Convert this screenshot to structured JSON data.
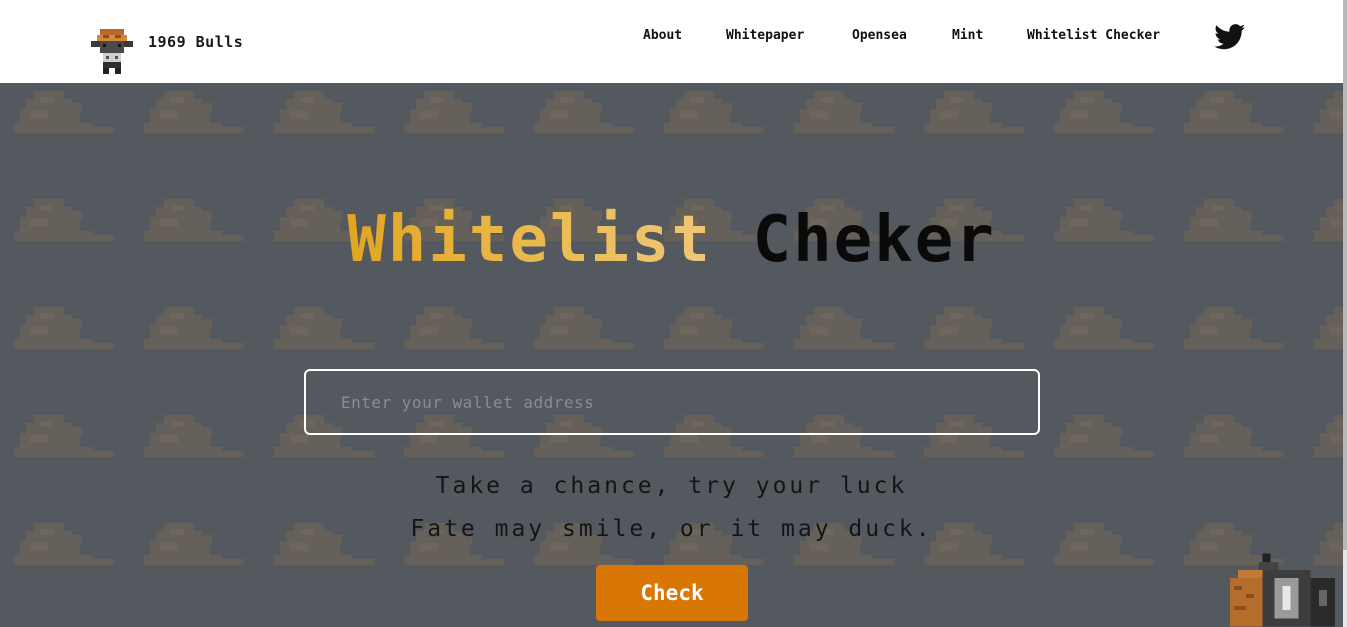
{
  "nav": {
    "brand": "1969 Bulls",
    "links": [
      "About",
      "Whitepaper",
      "Opensea",
      "Mint",
      "Whitelist Checker"
    ],
    "twitter_icon": "twitter-icon"
  },
  "hero": {
    "title_part1": "Whitelist",
    "title_part2": "Cheker",
    "input_placeholder": "Enter your wallet address",
    "tagline_line1": "Take a chance, try your luck",
    "tagline_line2": "Fate may smile, or it may duck.",
    "button_label": "Check"
  },
  "colors": {
    "accent": "#d97706",
    "title_gold": "#e3a521",
    "hero_bg": "#5a5d63"
  }
}
